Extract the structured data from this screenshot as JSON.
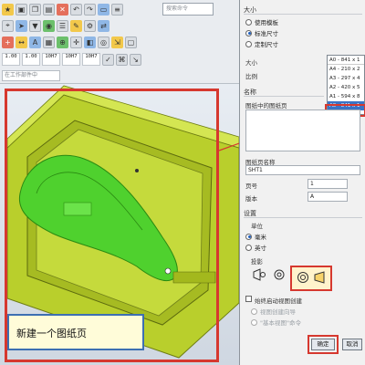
{
  "toolbar": {
    "search_placeholder": "搜索命令",
    "dimension_buttons": [
      "1.00",
      "1.00",
      "10H7",
      "10H7",
      "10H7"
    ],
    "filter_label": "在工作部件中"
  },
  "viewport": {
    "caption": "新建一个图纸页"
  },
  "dialog": {
    "size_section": "大小",
    "size_options": [
      "使用模板",
      "标准尺寸",
      "定制尺寸"
    ],
    "size_selected": 1,
    "size_label": "大小",
    "scale_label": "比例",
    "size_dropdown": [
      "A0 - 841 x 1",
      "A4 - 210 x 2",
      "A3 - 297 x 4",
      "A2 - 420 x 5",
      "A1 - 594 x 8",
      "A0 - 841 x 1"
    ],
    "size_dropdown_selected": 5,
    "name_section": "名称",
    "sheets_in_drawing_label": "图纸中的图纸页",
    "sheet_name_label": "图纸页名称",
    "sheet_name_value": "SHT1",
    "page_number_label": "页号",
    "page_number_value": "1",
    "revision_label": "版本",
    "revision_value": "A",
    "settings_section": "设置",
    "units_label": "单位",
    "units_options": [
      "毫米",
      "英寸"
    ],
    "units_selected": 0,
    "projection_label": "投影",
    "auto_start_label": "始终启动视图创建",
    "view_creation_options": [
      "视图创建向导",
      "\"基本视图\"命令"
    ],
    "ok_label": "确定",
    "cancel_label": "取消",
    "accent_color": "#d6382f",
    "selection_color": "#3a73c6"
  }
}
